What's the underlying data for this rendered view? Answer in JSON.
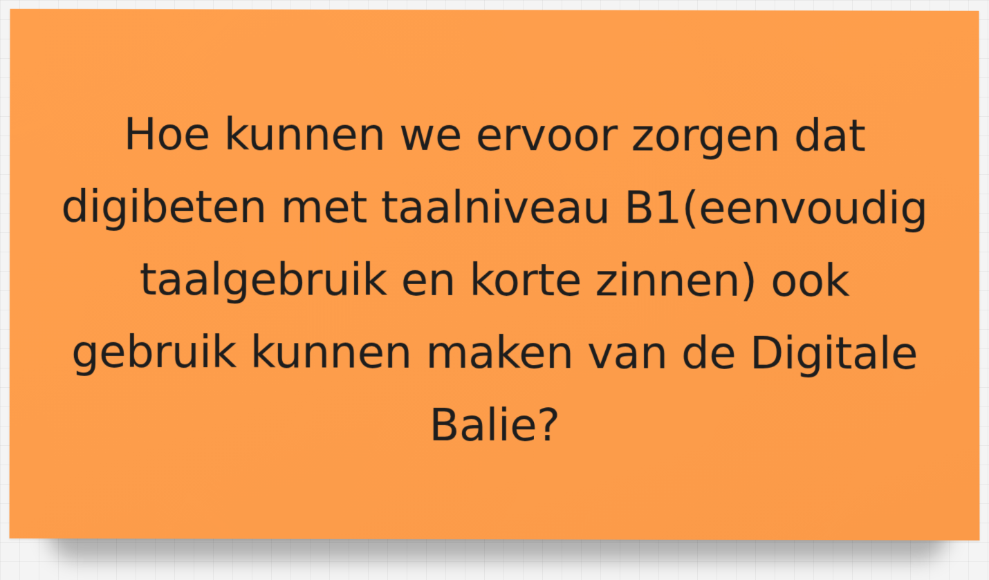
{
  "board": {
    "sticky_note": {
      "text": "Hoe kunnen we ervoor zorgen dat digibeten met taalniveau B1(eenvoudig taalgebruik en korte zinnen) ook gebruik kunnen maken van de Digitale Balie?",
      "color": "#fd9d4b",
      "text_color": "#1d1d1d"
    },
    "background_color": "#f4f4f4"
  }
}
